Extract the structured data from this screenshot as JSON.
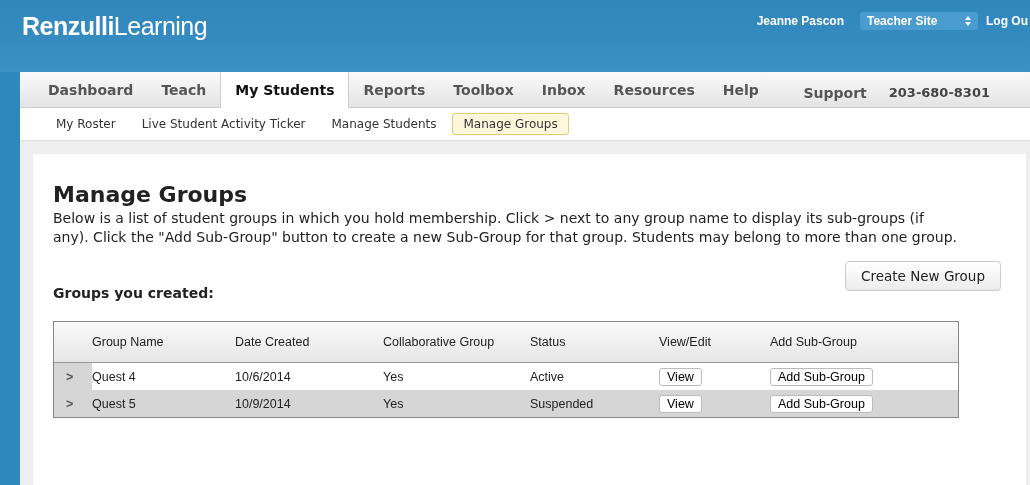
{
  "header": {
    "logo": "**Renzulli**Learning",
    "user": "Jeanne Pascon",
    "site_select": "Teacher Site",
    "logout": "Log Ou"
  },
  "tabs": [
    {
      "label": "Dashboard",
      "selected": false
    },
    {
      "label": "Teach",
      "selected": false
    },
    {
      "label": "My Students",
      "selected": true
    },
    {
      "label": "Reports",
      "selected": false
    },
    {
      "label": "Toolbox",
      "selected": false
    },
    {
      "label": "Inbox",
      "selected": false
    },
    {
      "label": "Resources",
      "selected": false
    },
    {
      "label": "Help",
      "selected": false
    }
  ],
  "support": {
    "label": "Support",
    "phone": "203-680-8301"
  },
  "subtabs": [
    {
      "label": "My Roster",
      "selected": false
    },
    {
      "label": "Live Student Activity Ticker",
      "selected": false
    },
    {
      "label": "Manage Students",
      "selected": false
    },
    {
      "label": "Manage Groups",
      "selected": true
    }
  ],
  "page": {
    "title": "Manage Groups",
    "description": "Below is a list of student groups in which you hold membership. Click > next to any group name to display its sub-groups (if any). Click the \"Add Sub-Group\" button to create a new Sub-Group for that group. Students may belong to more than one group.",
    "create_button": "Create New Group",
    "section_title": "Groups you created:"
  },
  "table": {
    "columns": [
      "Group Name",
      "Date Created",
      "Collaborative Group",
      "Status",
      "View/Edit",
      "Add Sub-Group"
    ],
    "rows": [
      {
        "expander": ">",
        "name": "Quest 4",
        "date": "10/6/2014",
        "collaborative": "Yes",
        "status": "Active",
        "view": "View",
        "add": "Add Sub-Group"
      },
      {
        "expander": ">",
        "name": "Quest 5",
        "date": "10/9/2014",
        "collaborative": "Yes",
        "status": "Suspended",
        "view": "View",
        "add": "Add Sub-Group"
      }
    ]
  }
}
